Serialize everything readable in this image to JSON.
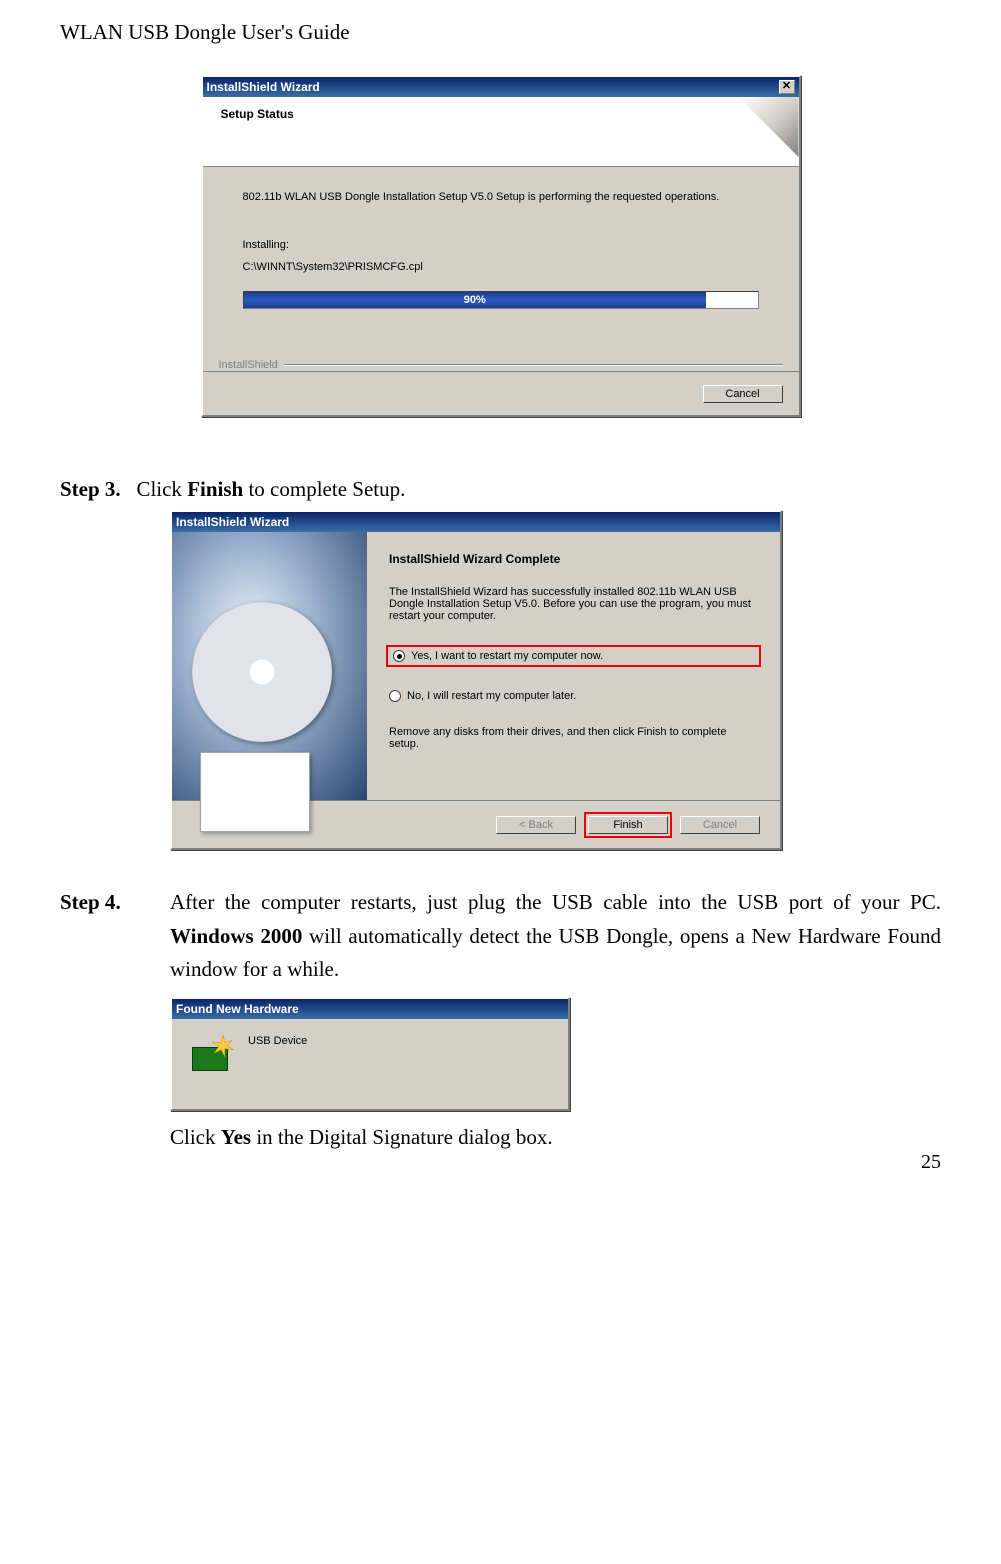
{
  "doc": {
    "header": "WLAN USB Dongle User's Guide",
    "page_number": "25"
  },
  "win1": {
    "title": "InstallShield Wizard",
    "close_glyph": "✕",
    "header_title": "Setup Status",
    "msg1": "802.11b WLAN USB Dongle Installation Setup V5.0 Setup is performing the requested operations.",
    "installing_label": "Installing:",
    "install_path": "C:\\WINNT\\System32\\PRISMCFG.cpl",
    "progress_pct": "90%",
    "divider_label": "InstallShield",
    "cancel_btn": "Cancel"
  },
  "step3": {
    "label": "Step 3.",
    "pre": "Click ",
    "bold": "Finish",
    "post": " to complete Setup."
  },
  "win2": {
    "title": "InstallShield Wizard",
    "main_title": "InstallShield Wizard Complete",
    "desc": "The InstallShield Wizard has successfully installed 802.11b WLAN USB Dongle Installation Setup V5.0.  Before you can use the program, you must restart your computer.",
    "opt_yes": "Yes, I want to restart my computer now.",
    "opt_no": "No, I will restart my computer later.",
    "remove": "Remove any disks from their drives, and then click Finish to complete setup.",
    "back_btn": "< Back",
    "finish_btn": "Finish",
    "cancel_btn": "Cancel"
  },
  "step4": {
    "label": "Step 4",
    "dot": ".",
    "line1_a": "After the computer restarts, just plug the USB cable into the USB port of your PC. ",
    "line1_bold": "Windows 2000",
    "line1_b": " will automatically detect the USB Dongle, opens a New Hardware Found window for a while.",
    "line2_a": "Click ",
    "line2_bold": "Yes",
    "line2_b": " in the Digital Signature dialog box."
  },
  "win3": {
    "title": "Found New Hardware",
    "device": "USB Device"
  }
}
